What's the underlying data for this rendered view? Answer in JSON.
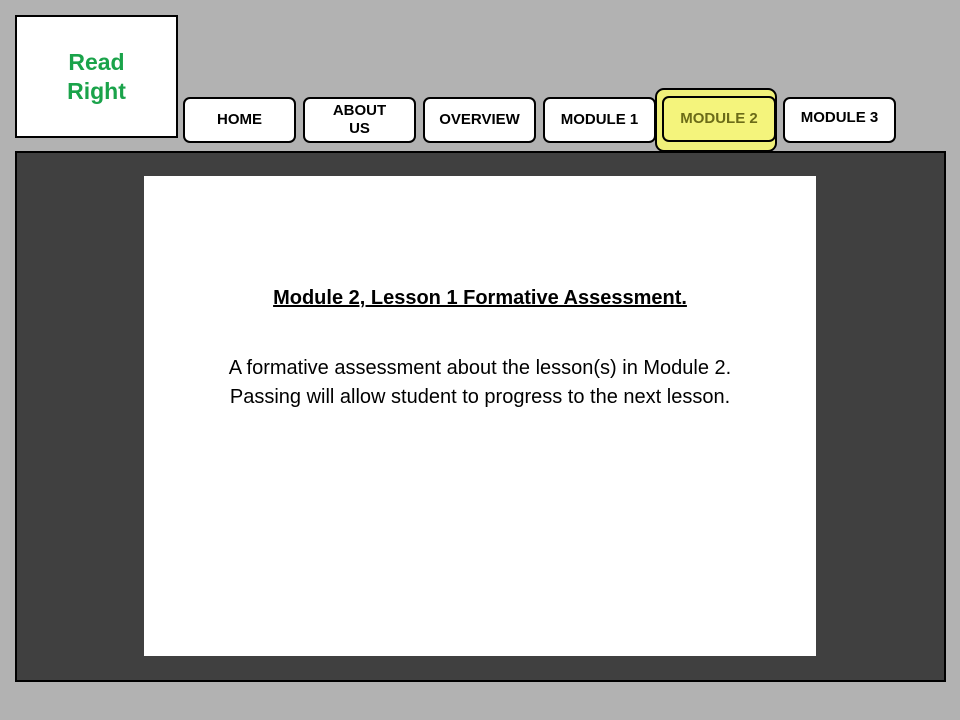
{
  "logo": {
    "text": "Read\nRight",
    "color": "#1aa34a"
  },
  "nav": {
    "items": [
      {
        "label": "HOME"
      },
      {
        "label": "ABOUT\nUS"
      },
      {
        "label": "OVERVIEW"
      },
      {
        "label": "MODULE 1"
      },
      {
        "label": "MODULE 2",
        "active": true
      },
      {
        "label": "MODULE 3"
      }
    ],
    "active_color": "#f4f47c"
  },
  "content": {
    "title": "Module 2, Lesson 1 Formative Assessment.",
    "description": "A formative assessment about the lesson(s) in Module 2.\nPassing will allow student to progress to the next lesson."
  }
}
